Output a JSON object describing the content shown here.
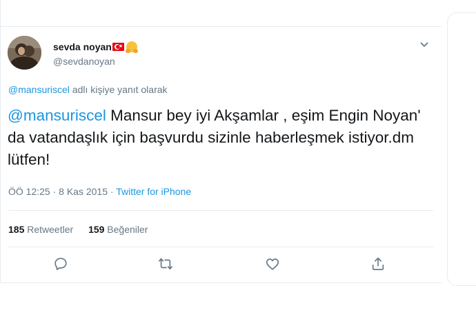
{
  "user": {
    "display_name": "sevda noyan",
    "handle": "@sevdanoyan",
    "flag_icon": "turkey-flag-emoji",
    "emoji_icon": "hugging-face-emoji"
  },
  "reply": {
    "mention": "@mansuriscel",
    "suffix": " adlı kişiye yanıt olarak"
  },
  "tweet": {
    "mention": "@mansuriscel",
    "text": " Mansur bey iyi Akşamlar , eşim Engin Noyan' da vatandaşlık için başvurdu sizinle haberleşmek istiyor.dm lütfen!"
  },
  "meta": {
    "time": "ÖÖ 12:25",
    "sep1": " · ",
    "date": "8 Kas 2015",
    "sep2": " · ",
    "source": "Twitter for iPhone"
  },
  "stats": {
    "retweets_count": "185",
    "retweets_label": " Retweetler",
    "likes_count": "159",
    "likes_label": " Beğeniler"
  },
  "actions": [
    "reply-icon",
    "retweet-icon",
    "like-icon",
    "share-icon"
  ],
  "colors": {
    "link": "#1b95e0",
    "muted": "#657786",
    "text": "#14171a",
    "border": "#e6ecf0"
  }
}
